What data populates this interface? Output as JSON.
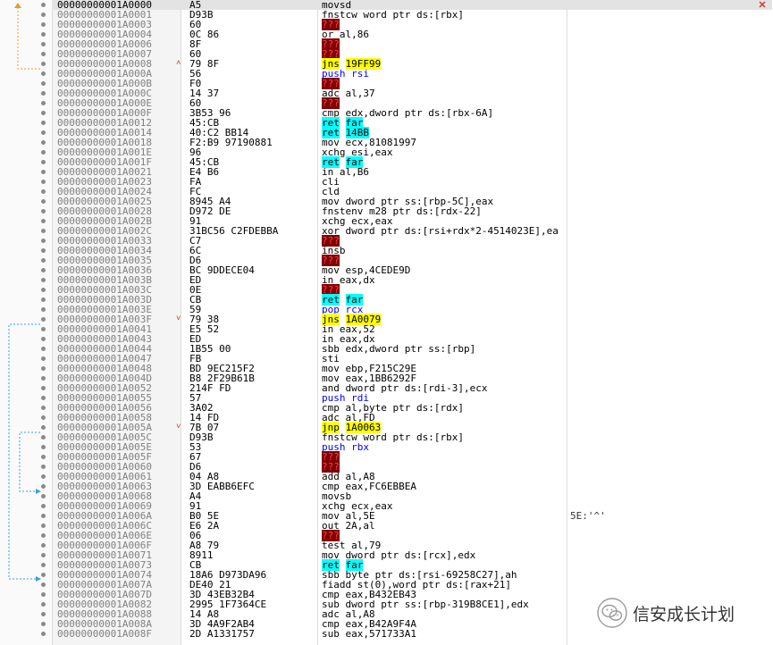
{
  "rows": [
    {
      "addr": "00000000001A0000",
      "bytes": "A5",
      "instr": "movsd",
      "kind": "plain",
      "selected": true
    },
    {
      "addr": "00000000001A0001",
      "bytes": "D93B",
      "instr": "fnstcw word ptr ds:[rbx]",
      "kind": "mem"
    },
    {
      "addr": "00000000001A0003",
      "bytes": "60",
      "instr": "???",
      "kind": "bad"
    },
    {
      "addr": "00000000001A0004",
      "bytes": "0C 86",
      "instr": "or al,86",
      "kind": "plain"
    },
    {
      "addr": "00000000001A0006",
      "bytes": "8F",
      "instr": "???",
      "kind": "bad"
    },
    {
      "addr": "00000000001A0007",
      "bytes": "60",
      "instr": "???",
      "kind": "bad"
    },
    {
      "addr": "00000000001A0008",
      "bytes": "79 8F",
      "instr": "jns 19FF99",
      "kind": "jmp",
      "mark": "^"
    },
    {
      "addr": "00000000001A000A",
      "bytes": "56",
      "instr": "push rsi",
      "kind": "push"
    },
    {
      "addr": "00000000001A000B",
      "bytes": "F0",
      "instr": "???",
      "kind": "bad"
    },
    {
      "addr": "00000000001A000C",
      "bytes": "14 37",
      "instr": "adc al,37",
      "kind": "plain"
    },
    {
      "addr": "00000000001A000E",
      "bytes": "60",
      "instr": "???",
      "kind": "bad"
    },
    {
      "addr": "00000000001A000F",
      "bytes": "3B53 96",
      "instr": "cmp edx,dword ptr ds:[rbx-6A]",
      "kind": "mem"
    },
    {
      "addr": "00000000001A0012",
      "bytes": "45:CB",
      "instr": "ret far",
      "kind": "ret"
    },
    {
      "addr": "00000000001A0014",
      "bytes": "40:C2 BB14",
      "instr": "ret 14BB",
      "kind": "ret"
    },
    {
      "addr": "00000000001A0018",
      "bytes": "F2:B9 97190881",
      "instr": "mov ecx,81081997",
      "kind": "plain"
    },
    {
      "addr": "00000000001A001E",
      "bytes": "96",
      "instr": "xchg esi,eax",
      "kind": "plain"
    },
    {
      "addr": "00000000001A001F",
      "bytes": "45:CB",
      "instr": "ret far",
      "kind": "ret"
    },
    {
      "addr": "00000000001A0021",
      "bytes": "E4 B6",
      "instr": "in al,B6",
      "kind": "plain"
    },
    {
      "addr": "00000000001A0023",
      "bytes": "FA",
      "instr": "cli",
      "kind": "plain"
    },
    {
      "addr": "00000000001A0024",
      "bytes": "FC",
      "instr": "cld",
      "kind": "plain"
    },
    {
      "addr": "00000000001A0025",
      "bytes": "8945 A4",
      "instr": "mov dword ptr ss:[rbp-5C],eax",
      "kind": "mem"
    },
    {
      "addr": "00000000001A0028",
      "bytes": "D972 DE",
      "instr": "fnstenv m28 ptr ds:[rdx-22]",
      "kind": "mem"
    },
    {
      "addr": "00000000001A002B",
      "bytes": "91",
      "instr": "xchg ecx,eax",
      "kind": "plain"
    },
    {
      "addr": "00000000001A002C",
      "bytes": "31BC56 C2FDEBBA",
      "instr": "xor dword ptr ds:[rsi+rdx*2-4514023E],ea",
      "kind": "mem"
    },
    {
      "addr": "00000000001A0033",
      "bytes": "C7",
      "instr": "???",
      "kind": "bad"
    },
    {
      "addr": "00000000001A0034",
      "bytes": "6C",
      "instr": "insb",
      "kind": "plain"
    },
    {
      "addr": "00000000001A0035",
      "bytes": "D6",
      "instr": "???",
      "kind": "bad"
    },
    {
      "addr": "00000000001A0036",
      "bytes": "BC 9DDECE04",
      "instr": "mov esp,4CEDE9D",
      "kind": "plain"
    },
    {
      "addr": "00000000001A003B",
      "bytes": "ED",
      "instr": "in eax,dx",
      "kind": "plain"
    },
    {
      "addr": "00000000001A003C",
      "bytes": "0E",
      "instr": "???",
      "kind": "bad"
    },
    {
      "addr": "00000000001A003D",
      "bytes": "CB",
      "instr": "ret far",
      "kind": "ret"
    },
    {
      "addr": "00000000001A003E",
      "bytes": "59",
      "instr": "pop rcx",
      "kind": "push"
    },
    {
      "addr": "00000000001A003F",
      "bytes": "79 38",
      "instr": "jns 1A0079",
      "kind": "jmp",
      "mark": "v"
    },
    {
      "addr": "00000000001A0041",
      "bytes": "E5 52",
      "instr": "in eax,52",
      "kind": "plain"
    },
    {
      "addr": "00000000001A0043",
      "bytes": "ED",
      "instr": "in eax,dx",
      "kind": "plain"
    },
    {
      "addr": "00000000001A0044",
      "bytes": "1B55 00",
      "instr": "sbb edx,dword ptr ss:[rbp]",
      "kind": "mem"
    },
    {
      "addr": "00000000001A0047",
      "bytes": "FB",
      "instr": "sti",
      "kind": "plain"
    },
    {
      "addr": "00000000001A0048",
      "bytes": "BD 9EC215F2",
      "instr": "mov ebp,F215C29E",
      "kind": "plain"
    },
    {
      "addr": "00000000001A004D",
      "bytes": "B8 2F29B61B",
      "instr": "mov eax,1BB6292F",
      "kind": "plain"
    },
    {
      "addr": "00000000001A0052",
      "bytes": "214F FD",
      "instr": "and dword ptr ds:[rdi-3],ecx",
      "kind": "mem"
    },
    {
      "addr": "00000000001A0055",
      "bytes": "57",
      "instr": "push rdi",
      "kind": "push"
    },
    {
      "addr": "00000000001A0056",
      "bytes": "3A02",
      "instr": "cmp al,byte ptr ds:[rdx]",
      "kind": "mem"
    },
    {
      "addr": "00000000001A0058",
      "bytes": "14 FD",
      "instr": "adc al,FD",
      "kind": "plain"
    },
    {
      "addr": "00000000001A005A",
      "bytes": "7B 07",
      "instr": "jnp 1A0063",
      "kind": "jmp",
      "mark": "v"
    },
    {
      "addr": "00000000001A005C",
      "bytes": "D93B",
      "instr": "fnstcw word ptr ds:[rbx]",
      "kind": "mem"
    },
    {
      "addr": "00000000001A005E",
      "bytes": "53",
      "instr": "push rbx",
      "kind": "push"
    },
    {
      "addr": "00000000001A005F",
      "bytes": "67",
      "instr": "???",
      "kind": "bad"
    },
    {
      "addr": "00000000001A0060",
      "bytes": "D6",
      "instr": "???",
      "kind": "bad"
    },
    {
      "addr": "00000000001A0061",
      "bytes": "04 A8",
      "instr": "add al,A8",
      "kind": "plain"
    },
    {
      "addr": "00000000001A0063",
      "bytes": "3D EABB6EFC",
      "instr": "cmp eax,FC6EBBEA",
      "kind": "plain"
    },
    {
      "addr": "00000000001A0068",
      "bytes": "A4",
      "instr": "movsb",
      "kind": "plain"
    },
    {
      "addr": "00000000001A0069",
      "bytes": "91",
      "instr": "xchg ecx,eax",
      "kind": "plain"
    },
    {
      "addr": "00000000001A006A",
      "bytes": "B0 5E",
      "instr": "mov al,5E",
      "kind": "plain",
      "comment": "5E:'^'"
    },
    {
      "addr": "00000000001A006C",
      "bytes": "E6 2A",
      "instr": "out 2A,al",
      "kind": "plain"
    },
    {
      "addr": "00000000001A006E",
      "bytes": "06",
      "instr": "???",
      "kind": "bad"
    },
    {
      "addr": "00000000001A006F",
      "bytes": "A8 79",
      "instr": "test al,79",
      "kind": "plain"
    },
    {
      "addr": "00000000001A0071",
      "bytes": "8911",
      "instr": "mov dword ptr ds:[rcx],edx",
      "kind": "mem"
    },
    {
      "addr": "00000000001A0073",
      "bytes": "CB",
      "instr": "ret far",
      "kind": "ret"
    },
    {
      "addr": "00000000001A0074",
      "bytes": "18A6 D973DA96",
      "instr": "sbb byte ptr ds:[rsi-69258C27],ah",
      "kind": "mem"
    },
    {
      "addr": "00000000001A007A",
      "bytes": "DE40 21",
      "instr": "fiadd st(0),word ptr ds:[rax+21]",
      "kind": "mem"
    },
    {
      "addr": "00000000001A007D",
      "bytes": "3D 43EB32B4",
      "instr": "cmp eax,B432EB43",
      "kind": "plain"
    },
    {
      "addr": "00000000001A0082",
      "bytes": "2995 1F7364CE",
      "instr": "sub dword ptr ss:[rbp-319B8CE1],edx",
      "kind": "mem"
    },
    {
      "addr": "00000000001A0088",
      "bytes": "14 A8",
      "instr": "adc al,A8",
      "kind": "plain"
    },
    {
      "addr": "00000000001A008A",
      "bytes": "3D 4A9F2AB4",
      "instr": "cmp eax,B42A9F4A",
      "kind": "plain"
    },
    {
      "addr": "00000000001A008F",
      "bytes": "2D A1331757",
      "instr": "sub eax,571733A1",
      "kind": "plain"
    }
  ],
  "watermark": {
    "text": "信安成长计划",
    "icon": "wechat-icon"
  },
  "colors": {
    "jump_highlight": "#ffff00",
    "ret_highlight": "#00ffff",
    "invalid_bg": "#800000",
    "invalid_fg": "#ff4040",
    "push_fg": "#0000ff",
    "arrow_orange": "#e0a030",
    "arrow_blue": "#3aa0d8"
  }
}
